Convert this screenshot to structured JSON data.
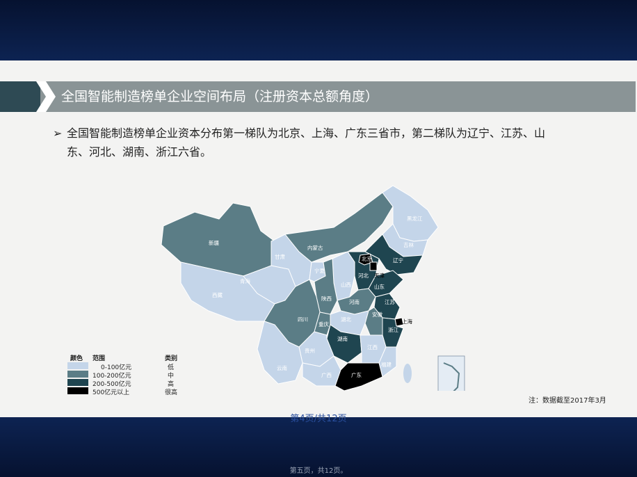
{
  "title": "全国智能制造榜单企业空间布局（注册资本总额角度）",
  "bullet": {
    "arrow": "➢",
    "line1": "全国智能制造榜单企业资本分布第一梯队为北京、上海、广东三省市，第二梯队为辽宁、江苏、山",
    "line2": "东、河北、湖南、浙江六省。"
  },
  "map": {
    "provinces": [
      "黑龙江",
      "吉林",
      "辽宁",
      "北京",
      "天津",
      "河北",
      "山西",
      "山东",
      "内蒙古",
      "宁夏",
      "新疆",
      "甘肃",
      "青海",
      "西藏",
      "四川",
      "重庆",
      "陕西",
      "河南",
      "湖北",
      "安徽",
      "江苏",
      "上海",
      "浙江",
      "江西",
      "湖南",
      "福建",
      "贵州",
      "云南",
      "广西",
      "广东"
    ]
  },
  "legend": {
    "headers": {
      "color": "颜色",
      "range": "范围",
      "category": "类别"
    },
    "items": [
      {
        "range": "0-100亿元",
        "category": "低",
        "color": "#c4d5e9"
      },
      {
        "range": "100-200亿元",
        "category": "中",
        "color": "#5b7d86"
      },
      {
        "range": "200-500亿元",
        "category": "高",
        "color": "#1f4550"
      },
      {
        "range": "500亿元以上",
        "category": "很高",
        "color": "#000000"
      }
    ]
  },
  "note": "注：数据截至2017年3月",
  "page_number": "第4页/共12页",
  "footer": "第五页，共12页。",
  "colors": {
    "low": "#c4d5e9",
    "mid": "#5b7d86",
    "high": "#1f4550",
    "veryhigh": "#000000",
    "title_bar": "#8a9496"
  }
}
